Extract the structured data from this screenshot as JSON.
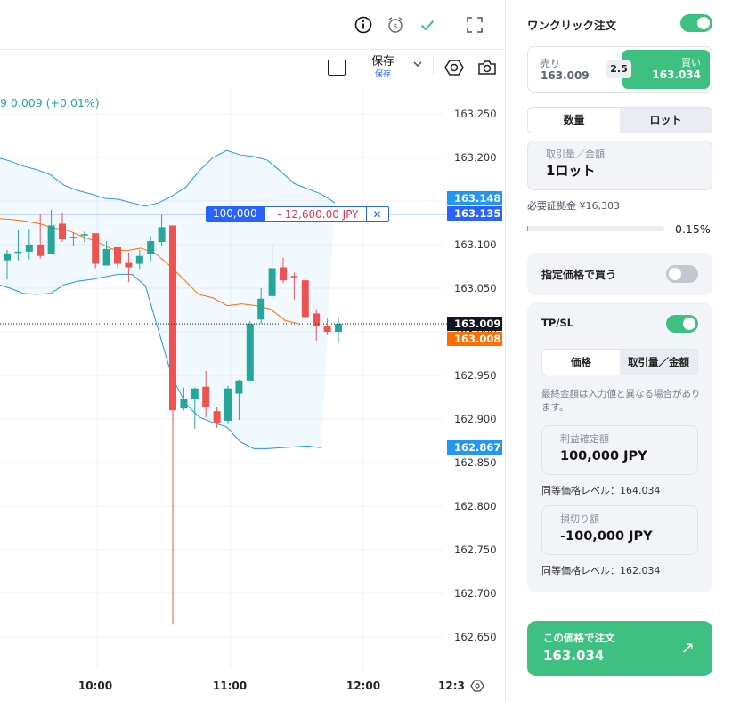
{
  "toolbar": {
    "save_label": "保存",
    "save_sublabel": "保存"
  },
  "legend": {
    "price_change": "9  0.009 (+0.01%)"
  },
  "price_axis": {
    "ticks": [
      "163.250",
      "163.200",
      "163.150",
      "163.100",
      "163.050",
      "163.000",
      "162.950",
      "162.900",
      "162.850",
      "162.800",
      "162.750",
      "162.700",
      "162.650"
    ]
  },
  "time_axis": {
    "ticks": [
      "10:00",
      "11:00",
      "12:00",
      "12:3"
    ]
  },
  "price_tags": {
    "upper_band": "163.148",
    "order_line": "163.135",
    "current_bid": "163.009",
    "current_ask": "163.008",
    "lower_band": "162.867"
  },
  "order_line": {
    "quantity": "100,000",
    "pnl": "- 12,600.00 JPY",
    "close": "✕"
  },
  "colors": {
    "up": "#26a69a",
    "down": "#ef5350",
    "bands": "#2196f3",
    "basis": "#ff6d00",
    "order_line": "#2962ff",
    "accent_green": "#3ec180"
  },
  "chart_data": {
    "type": "candlestick",
    "xlim": [
      "09:00",
      "12:30"
    ],
    "ylim": [
      162.63,
      163.27
    ],
    "candles": [
      {
        "t": 0,
        "o": 163.082,
        "h": 163.094,
        "l": 163.06,
        "c": 163.09
      },
      {
        "t": 1,
        "o": 163.091,
        "h": 163.117,
        "l": 163.082,
        "c": 163.092
      },
      {
        "t": 2,
        "o": 163.092,
        "h": 163.118,
        "l": 163.083,
        "c": 163.1
      },
      {
        "t": 3,
        "o": 163.1,
        "h": 163.135,
        "l": 163.084,
        "c": 163.087
      },
      {
        "t": 4,
        "o": 163.089,
        "h": 163.14,
        "l": 163.089,
        "c": 163.122
      },
      {
        "t": 5,
        "o": 163.124,
        "h": 163.137,
        "l": 163.103,
        "c": 163.106
      },
      {
        "t": 6,
        "o": 163.109,
        "h": 163.114,
        "l": 163.098,
        "c": 163.109
      },
      {
        "t": 7,
        "o": 163.112,
        "h": 163.115,
        "l": 163.103,
        "c": 163.112
      },
      {
        "t": 8,
        "o": 163.113,
        "h": 163.113,
        "l": 163.073,
        "c": 163.078
      },
      {
        "t": 9,
        "o": 163.076,
        "h": 163.104,
        "l": 163.076,
        "c": 163.095
      },
      {
        "t": 10,
        "o": 163.097,
        "h": 163.097,
        "l": 163.073,
        "c": 163.078
      },
      {
        "t": 11,
        "o": 163.079,
        "h": 163.091,
        "l": 163.057,
        "c": 163.074
      },
      {
        "t": 12,
        "o": 163.078,
        "h": 163.094,
        "l": 163.072,
        "c": 163.087
      },
      {
        "t": 13,
        "o": 163.089,
        "h": 163.11,
        "l": 163.081,
        "c": 163.104
      },
      {
        "t": 14,
        "o": 163.103,
        "h": 163.134,
        "l": 163.099,
        "c": 163.12
      },
      {
        "t": 15,
        "o": 163.122,
        "h": 163.12,
        "l": 162.664,
        "c": 162.91
      },
      {
        "t": 16,
        "o": 162.912,
        "h": 162.936,
        "l": 162.91,
        "c": 162.923
      },
      {
        "t": 17,
        "o": 162.923,
        "h": 162.936,
        "l": 162.889,
        "c": 162.935
      },
      {
        "t": 18,
        "o": 162.937,
        "h": 162.955,
        "l": 162.902,
        "c": 162.914
      },
      {
        "t": 19,
        "o": 162.909,
        "h": 162.914,
        "l": 162.89,
        "c": 162.895
      },
      {
        "t": 20,
        "o": 162.898,
        "h": 162.938,
        "l": 162.894,
        "c": 162.935
      },
      {
        "t": 21,
        "o": 162.929,
        "h": 162.945,
        "l": 162.899,
        "c": 162.944
      },
      {
        "t": 22,
        "o": 162.944,
        "h": 163.012,
        "l": 162.945,
        "c": 163.009
      },
      {
        "t": 23,
        "o": 163.014,
        "h": 163.05,
        "l": 163.009,
        "c": 163.038
      },
      {
        "t": 24,
        "o": 163.041,
        "h": 163.1,
        "l": 163.038,
        "c": 163.073
      },
      {
        "t": 25,
        "o": 163.074,
        "h": 163.085,
        "l": 163.056,
        "c": 163.059
      },
      {
        "t": 26,
        "o": 163.064,
        "h": 163.068,
        "l": 163.037,
        "c": 163.063
      },
      {
        "t": 27,
        "o": 163.059,
        "h": 163.061,
        "l": 163.015,
        "c": 163.017
      },
      {
        "t": 28,
        "o": 163.021,
        "h": 163.026,
        "l": 162.99,
        "c": 163.006
      },
      {
        "t": 29,
        "o": 163.007,
        "h": 163.015,
        "l": 162.996,
        "c": 163.0
      },
      {
        "t": 30,
        "o": 163.0,
        "h": 163.017,
        "l": 162.987,
        "c": 163.009
      }
    ],
    "series": [
      {
        "name": "",
        "type": "bollinger_upper",
        "values": [
          163.2,
          163.196,
          163.19,
          163.186,
          163.18,
          163.168,
          163.162,
          163.158,
          163.153,
          163.152,
          163.148,
          163.144,
          163.148,
          163.156,
          163.166,
          163.185,
          163.2,
          163.208,
          163.203,
          163.201,
          163.197,
          163.184,
          163.17,
          163.164,
          163.158,
          163.148
        ]
      },
      {
        "name": "",
        "type": "bollinger_lower",
        "values": [
          163.055,
          163.05,
          163.044,
          163.043,
          163.044,
          163.054,
          163.058,
          163.06,
          163.063,
          163.066,
          163.066,
          163.053,
          163.0,
          162.947,
          162.917,
          162.902,
          162.896,
          162.891,
          162.874,
          162.866,
          162.866,
          162.867,
          162.868,
          162.869,
          162.867
        ]
      },
      {
        "name": "",
        "type": "basis",
        "values": [
          163.13,
          163.129,
          163.127,
          163.124,
          163.119,
          163.116,
          163.109,
          163.103,
          163.095,
          163.093,
          163.096,
          163.09,
          163.076,
          163.06,
          163.043,
          163.039,
          163.03,
          163.032,
          163.03,
          163.026,
          163.013,
          163.009
        ]
      }
    ],
    "order_line_price": 163.135,
    "last_price": 163.009
  },
  "panel": {
    "one_click_label": "ワンクリック注文",
    "one_click_on": true,
    "sell_label": "売り",
    "sell_price": "163.009",
    "spread": "2.5",
    "buy_label": "買い",
    "buy_price": "163.034",
    "unit_tabs": [
      "数量",
      "ロット"
    ],
    "unit_active_index": 1,
    "qty_label": "取引量／金額",
    "qty_value": "1ロット",
    "margin_text": "必要証拠金 ¥16,303",
    "margin_pct": "0.15%",
    "margin_fraction": 0.0015,
    "limit_label": "指定価格で買う",
    "limit_on": false,
    "tpsl_label": "TP/SL",
    "tpsl_on": true,
    "tpsl_tabs": [
      "価格",
      "取引量／金額"
    ],
    "tpsl_active_index": 1,
    "tpsl_note": "最終金額は入力値と異なる場合があります。",
    "tp_label": "利益確定額",
    "tp_value": "100,000 JPY",
    "tp_level": "同等価格レベル：164.034",
    "sl_label": "損切り額",
    "sl_value": "-100,000 JPY",
    "sl_level": "同等価格レベル：162.034",
    "order_button_label": "この価格で注文",
    "order_button_price": "163.034",
    "order_button_arrow": "↗"
  }
}
